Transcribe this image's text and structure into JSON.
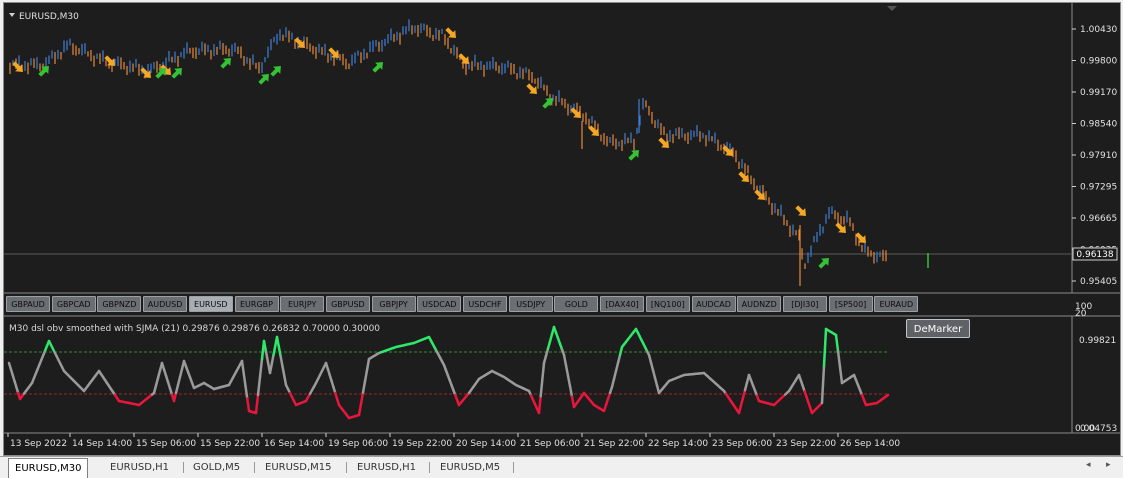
{
  "chart": {
    "symbol_label": "EURUSD,M30",
    "current_price": "0.96138",
    "price_axis": [
      "1.00430",
      "0.99800",
      "0.99170",
      "0.98540",
      "0.97910",
      "0.97295",
      "0.96665",
      "0.96035",
      "0.95405"
    ],
    "time_axis": [
      "13 Sep 2022",
      "14 Sep 14:00",
      "15 Sep 06:00",
      "15 Sep 22:00",
      "16 Sep 14:00",
      "19 Sep 06:00",
      "19 Sep 22:00",
      "20 Sep 14:00",
      "21 Sep 06:00",
      "21 Sep 22:00",
      "22 Sep 14:00",
      "23 Sep 06:00",
      "23 Sep 22:00",
      "26 Sep 14:00"
    ],
    "colors": {
      "bull": "#3d7fd6",
      "bear": "#e8893a",
      "arrow_up": "#34c334",
      "arrow_down": "#f5a623",
      "indicator_high": "#2ee86a",
      "indicator_mid": "#9a9a9a",
      "indicator_low": "#e8163c"
    }
  },
  "symbol_buttons": [
    "GBPAUD",
    "GBPCAD",
    "GBPNZD",
    "AUDUSD",
    "EURUSD",
    "EURGBP",
    "EURJPY",
    "GBPUSD",
    "GBPJPY",
    "USDCAD",
    "USDCHF",
    "USDJPY",
    "GOLD",
    "[DAX40]",
    "[NQ100]",
    "AUDCAD",
    "AUDNZD",
    "[DJI30]",
    "[SP500]",
    "EURAUD"
  ],
  "active_symbol": "EURUSD",
  "indicator": {
    "label": "M30 dsl obv smoothed with SJMA (21) 0.29876 0.29876 0.26832 0.70000 0.30000",
    "axis_top": "100",
    "axis_20": "20",
    "value_top": "0.99821",
    "value_bottom": "0.04753",
    "value_bottom2": "0.00",
    "demarker_label": "DeMarker"
  },
  "tabs": [
    "EURUSD,M30",
    "EURUSD,H1",
    "GOLD,M5",
    "EURUSD,M15",
    "EURUSD,H1",
    "EURUSD,M5"
  ]
}
